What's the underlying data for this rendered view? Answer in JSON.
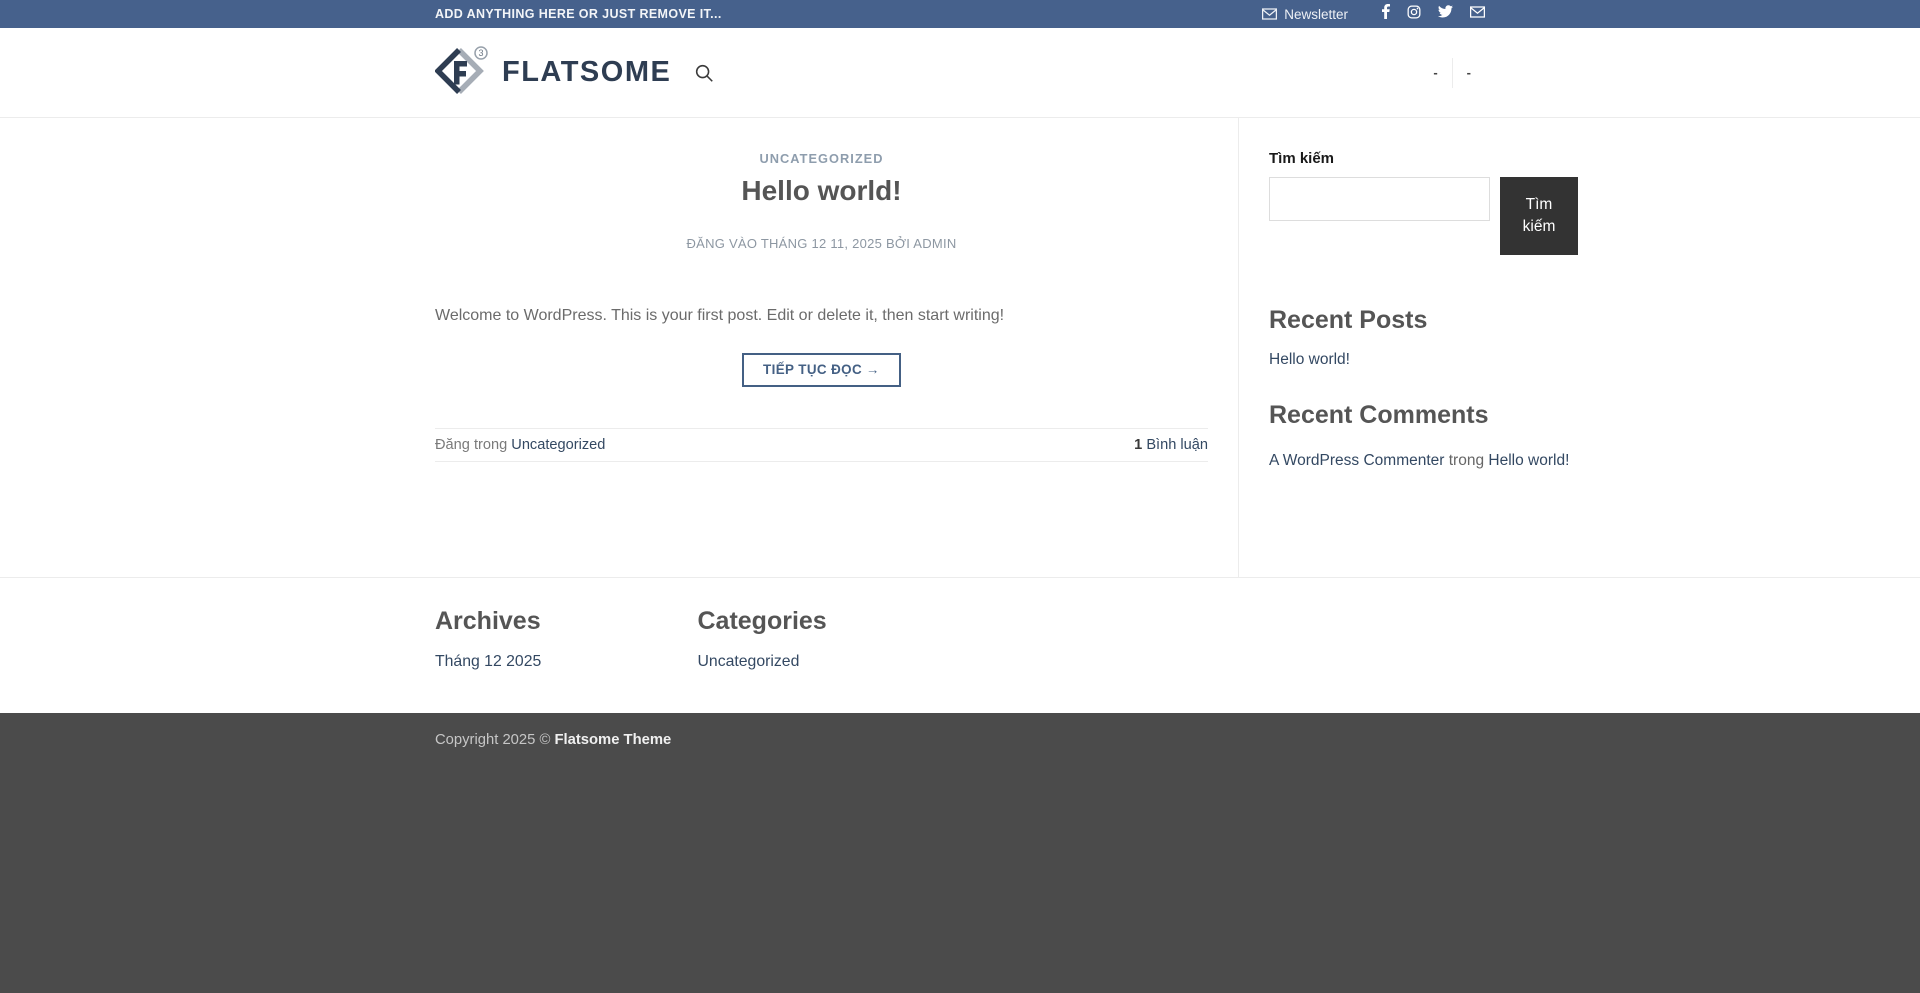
{
  "topbar": {
    "message": "ADD ANYTHING HERE OR JUST REMOVE IT...",
    "newsletter_label": "Newsletter",
    "social_icons": [
      "envelope-icon",
      "facebook-icon",
      "instagram-icon",
      "twitter-icon",
      "email-icon"
    ]
  },
  "header": {
    "logo_text": "FLATSOME",
    "logo_superscript": "3",
    "menu_item_1": "-",
    "menu_item_2": "-",
    "search_icon": "search-icon"
  },
  "post": {
    "category": "UNCATEGORIZED",
    "title": "Hello world!",
    "meta": "ĐĂNG VÀO THÁNG 12 11, 2025 BỞI ADMIN",
    "body": "Welcome to WordPress. This is your first post. Edit or delete it, then start writing!",
    "read_more_label": "TIẾP TỤC ĐỌC →",
    "posted_in_label": "Đăng trong",
    "posted_in_category": "Uncategorized",
    "comments_count": "1",
    "comments_label": "Bình luận"
  },
  "sidebar": {
    "search": {
      "label": "Tìm kiếm",
      "button_label": "Tìm kiếm",
      "input_value": ""
    },
    "recent_posts": {
      "heading": "Recent Posts",
      "items": [
        "Hello world!"
      ]
    },
    "recent_comments": {
      "heading": "Recent Comments",
      "items": [
        {
          "author": "A WordPress Commenter",
          "connector": "trong",
          "post": "Hello world!"
        }
      ]
    }
  },
  "footer": {
    "archives": {
      "heading": "Archives",
      "items": [
        "Tháng 12 2025"
      ]
    },
    "categories": {
      "heading": "Categories",
      "items": [
        "Uncategorized"
      ]
    },
    "copyright_prefix": "Copyright 2025 © ",
    "copyright_brand": "Flatsome Theme"
  },
  "colors": {
    "topbar_bg": "#46618c",
    "primary": "#446084",
    "link": "#334862",
    "heading": "#555555",
    "search_button_bg": "#333333",
    "absolute_footer_bg": "#4b4b4b",
    "border": "#ececec"
  }
}
